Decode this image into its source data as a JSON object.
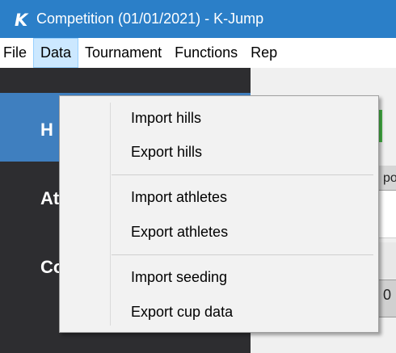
{
  "window": {
    "title": "Competition (01/01/2021) - K-Jump",
    "app_icon": "k-jump-logo-icon",
    "icon_letter": "K"
  },
  "menubar": {
    "items": [
      {
        "label": "File",
        "active": false
      },
      {
        "label": "Data",
        "active": true
      },
      {
        "label": "Tournament",
        "active": false
      },
      {
        "label": "Functions",
        "active": false
      },
      {
        "label": "Rep",
        "active": false
      }
    ]
  },
  "data_menu": {
    "groups": [
      [
        "Import hills",
        "Export hills"
      ],
      [
        "Import athletes",
        "Export athletes"
      ],
      [
        "Import seeding",
        "Export cup data"
      ]
    ]
  },
  "background": {
    "sidebar_items": [
      "H",
      "At",
      "Co"
    ],
    "cell_fragment": "po",
    "value_fragment": "0"
  },
  "colors": {
    "titlebar": "#2b7fc8",
    "menu_active": "#cce8ff",
    "sidebar": "#2d2d30",
    "sidebar_active": "#3f7fbf",
    "accent_green": "#48b948"
  }
}
